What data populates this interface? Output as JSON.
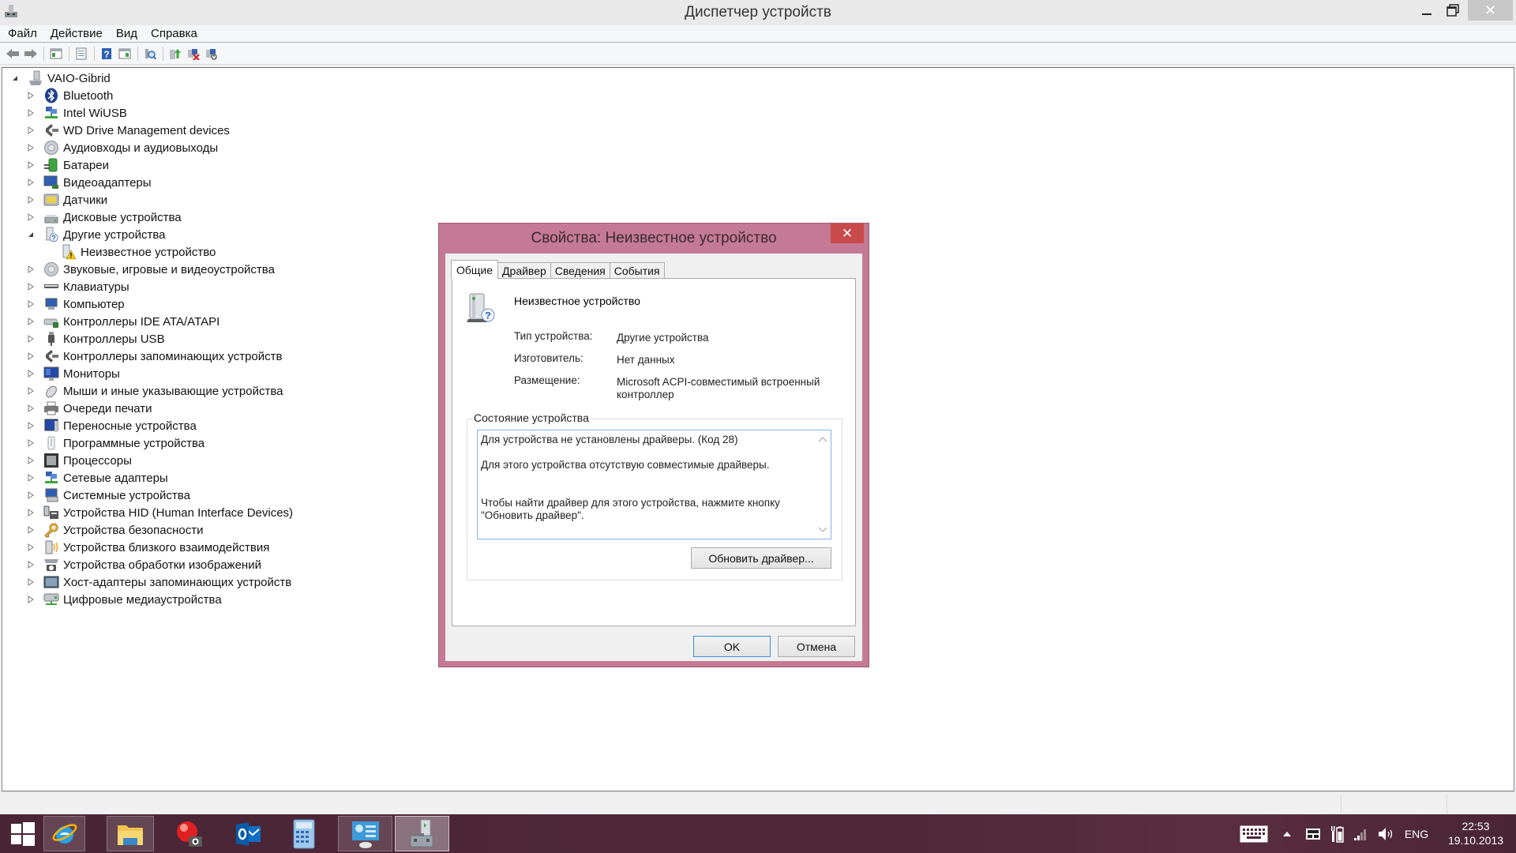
{
  "window": {
    "title": "Диспетчер устройств",
    "controls": {
      "minimize": "—",
      "maximize": "❐",
      "close": "✕"
    }
  },
  "menubar": {
    "items": [
      {
        "label": "Файл"
      },
      {
        "label": "Действие"
      },
      {
        "label": "Вид"
      },
      {
        "label": "Справка"
      }
    ]
  },
  "toolbar": {
    "buttons": [
      {
        "name": "back-icon"
      },
      {
        "name": "forward-icon"
      },
      {
        "name": "show-hide-console-tree-icon"
      },
      {
        "name": "properties-icon"
      },
      {
        "name": "help-icon"
      },
      {
        "name": "show-hide-action-pane-icon"
      },
      {
        "name": "scan-hardware-icon"
      },
      {
        "name": "update-driver-icon"
      },
      {
        "name": "uninstall-icon"
      },
      {
        "name": "disable-device-icon"
      }
    ]
  },
  "tree": {
    "root": {
      "label": "VAIO-Gibrid",
      "expanded": true,
      "icon": "computer-icon"
    },
    "items": [
      {
        "label": "Bluetooth",
        "icon": "bluetooth-icon",
        "level": 1,
        "expanded": false
      },
      {
        "label": "Intel WiUSB",
        "icon": "network-icon",
        "level": 1,
        "expanded": false
      },
      {
        "label": "WD Drive Management devices",
        "icon": "storage-controller-icon",
        "level": 1,
        "expanded": false
      },
      {
        "label": "Аудиовходы и аудиовыходы",
        "icon": "speaker-icon",
        "level": 1,
        "expanded": false
      },
      {
        "label": "Батареи",
        "icon": "battery-icon",
        "level": 1,
        "expanded": false
      },
      {
        "label": "Видеоадаптеры",
        "icon": "display-adapter-icon",
        "level": 1,
        "expanded": false
      },
      {
        "label": "Датчики",
        "icon": "sensor-icon",
        "level": 1,
        "expanded": false
      },
      {
        "label": "Дисковые устройства",
        "icon": "disk-drive-icon",
        "level": 1,
        "expanded": false
      },
      {
        "label": "Другие устройства",
        "icon": "other-devices-icon",
        "level": 1,
        "expanded": true
      },
      {
        "label": "Неизвестное устройство",
        "icon": "unknown-device-warning-icon",
        "level": 2,
        "expanded": null
      },
      {
        "label": "Звуковые, игровые и видеоустройства",
        "icon": "speaker-icon",
        "level": 1,
        "expanded": false
      },
      {
        "label": "Клавиатуры",
        "icon": "keyboard-icon",
        "level": 1,
        "expanded": false
      },
      {
        "label": "Компьютер",
        "icon": "computer-monitor-icon",
        "level": 1,
        "expanded": false
      },
      {
        "label": "Контроллеры IDE ATA/ATAPI",
        "icon": "ide-controller-icon",
        "level": 1,
        "expanded": false
      },
      {
        "label": "Контроллеры USB",
        "icon": "usb-icon",
        "level": 1,
        "expanded": false
      },
      {
        "label": "Контроллеры запоминающих устройств",
        "icon": "storage-controller-icon",
        "level": 1,
        "expanded": false
      },
      {
        "label": "Мониторы",
        "icon": "monitor-icon",
        "level": 1,
        "expanded": false
      },
      {
        "label": "Мыши и иные указывающие устройства",
        "icon": "mouse-icon",
        "level": 1,
        "expanded": false
      },
      {
        "label": "Очереди печати",
        "icon": "printer-icon",
        "level": 1,
        "expanded": false
      },
      {
        "label": "Переносные устройства",
        "icon": "portable-device-icon",
        "level": 1,
        "expanded": false
      },
      {
        "label": "Программные устройства",
        "icon": "software-device-icon",
        "level": 1,
        "expanded": false
      },
      {
        "label": "Процессоры",
        "icon": "processor-icon",
        "level": 1,
        "expanded": false
      },
      {
        "label": "Сетевые адаптеры",
        "icon": "network-icon",
        "level": 1,
        "expanded": false
      },
      {
        "label": "Системные устройства",
        "icon": "system-device-icon",
        "level": 1,
        "expanded": false
      },
      {
        "label": "Устройства HID (Human Interface Devices)",
        "icon": "hid-icon",
        "level": 1,
        "expanded": false
      },
      {
        "label": "Устройства безопасности",
        "icon": "security-key-icon",
        "level": 1,
        "expanded": false
      },
      {
        "label": "Устройства близкого взаимодействия",
        "icon": "proximity-icon",
        "level": 1,
        "expanded": false
      },
      {
        "label": "Устройства обработки изображений",
        "icon": "imaging-icon",
        "level": 1,
        "expanded": false
      },
      {
        "label": "Хост-адаптеры запоминающих устройств",
        "icon": "storage-adapter-icon",
        "level": 1,
        "expanded": false
      },
      {
        "label": "Цифровые медиаустройства",
        "icon": "media-device-icon",
        "level": 1,
        "expanded": false
      }
    ]
  },
  "dialog": {
    "title": "Свойства: Неизвестное устройство",
    "close": "✕",
    "tabs": [
      {
        "label": "Общие",
        "active": true
      },
      {
        "label": "Драйвер",
        "active": false
      },
      {
        "label": "Сведения",
        "active": false
      },
      {
        "label": "События",
        "active": false
      }
    ],
    "device_name": "Неизвестное устройство",
    "properties": [
      {
        "label": "Тип устройства:",
        "value": "Другие устройства"
      },
      {
        "label": "Изготовитель:",
        "value": "Нет данных"
      },
      {
        "label": "Размещение:",
        "value": "Microsoft ACPI-совместимый встроенный контроллер"
      }
    ],
    "status_group_label": "Состояние устройства",
    "status_lines": [
      "Для устройства не установлены драйверы. (Код 28)",
      "Для этого устройства отсутствую совместимые драйверы.",
      "Чтобы найти драйвер для этого устройства, нажмите кнопку \"Обновить драйвер\"."
    ],
    "update_driver_button": "Обновить драйвер...",
    "ok_button": "OK",
    "cancel_button": "Отмена"
  },
  "taskbar": {
    "apps": [
      {
        "name": "internet-explorer",
        "state": "pinned-open"
      },
      {
        "name": "file-explorer",
        "state": "pinned-open"
      },
      {
        "name": "camera-app",
        "state": "pinned"
      },
      {
        "name": "outlook",
        "state": "pinned"
      },
      {
        "name": "calculator",
        "state": "pinned"
      },
      {
        "name": "control-panel",
        "state": "pinned-open"
      },
      {
        "name": "device-manager",
        "state": "active"
      }
    ],
    "tray": {
      "language": "ENG",
      "time": "22:53",
      "date": "19.10.2013"
    }
  },
  "colors": {
    "dialog_frame": "#c47a94",
    "dialog_close": "#c94a4a",
    "taskbar": "#4a2535",
    "ok_focus_border": "#3c8fd8"
  }
}
